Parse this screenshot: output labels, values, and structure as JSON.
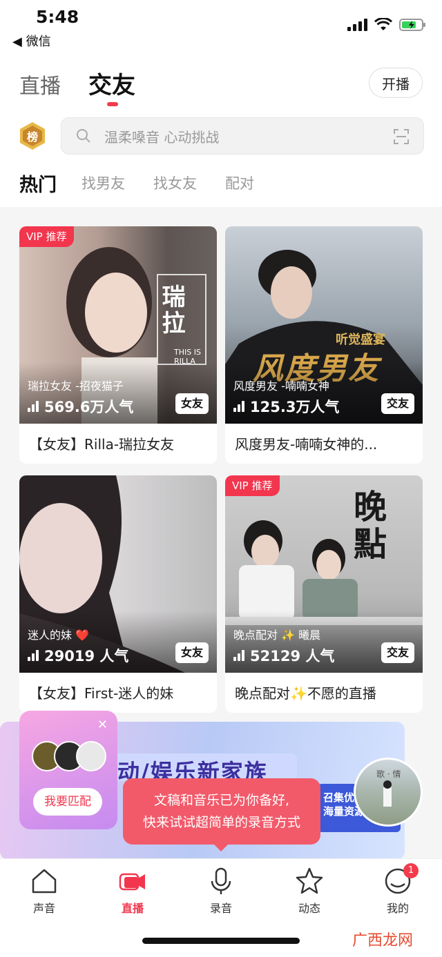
{
  "status_bar": {
    "time": "5:48",
    "back_app": "◀ 微信"
  },
  "header": {
    "tabs": [
      {
        "label": "直播"
      },
      {
        "label": "交友"
      }
    ],
    "active_tab": "交友",
    "broadcast_button": "开播"
  },
  "search": {
    "placeholder": "温柔嗓音 心动挑战",
    "rank_badge": "榜"
  },
  "sub_tabs": [
    {
      "label": "热门"
    },
    {
      "label": "找男友"
    },
    {
      "label": "找女友"
    },
    {
      "label": "配对"
    }
  ],
  "cards": [
    {
      "vip": "VIP 推荐",
      "streamer": "瑞拉女友 -招夜猫子",
      "popularity": "569.6万人气",
      "tag": "女友",
      "title": "【女友】Rilla-瑞拉女友",
      "overlay_text": "瑞拉",
      "overlay_sub": "THIS IS RILLA"
    },
    {
      "vip": "",
      "streamer": "风度男友 -喃喃女神",
      "popularity": "125.3万人气",
      "tag": "交友",
      "title": "风度男友-喃喃女神的...",
      "overlay_text": "风度男友",
      "overlay_sub": "听觉盛宴"
    },
    {
      "vip": "",
      "streamer": "迷人的妹 ❤️",
      "popularity": "29019 人气",
      "tag": "女友",
      "title": "【女友】First-迷人的妹",
      "overlay_text": "",
      "overlay_sub": ""
    },
    {
      "vip": "VIP 推荐",
      "streamer": "晚点配对 ✨ 曦晨",
      "popularity": "52129 人气",
      "tag": "交友",
      "title": "晚点配对✨不愿的直播",
      "overlay_text": "晚點",
      "overlay_sub": ""
    }
  ],
  "banner": {
    "headline": "动/娱乐新家族",
    "box_text": "召集优质\n海量资源"
  },
  "match_popup": {
    "button": "我要匹配"
  },
  "tooltip": {
    "line1": "文稿和音乐已为你备好,",
    "line2": "快来试试超简单的录音方式"
  },
  "floating_live": {
    "text": "歌 · 情"
  },
  "bottom_nav": [
    {
      "label": "声音",
      "icon": "house-icon"
    },
    {
      "label": "直播",
      "icon": "video-camera-icon"
    },
    {
      "label": "录音",
      "icon": "microphone-icon"
    },
    {
      "label": "动态",
      "icon": "star-icon"
    },
    {
      "label": "我的",
      "icon": "profile-icon",
      "badge": "1"
    }
  ],
  "watermark": "广西龙网",
  "colors": {
    "accent": "#f23b4b",
    "tooltip": "#f25a6a",
    "vip": "#f2364e"
  }
}
